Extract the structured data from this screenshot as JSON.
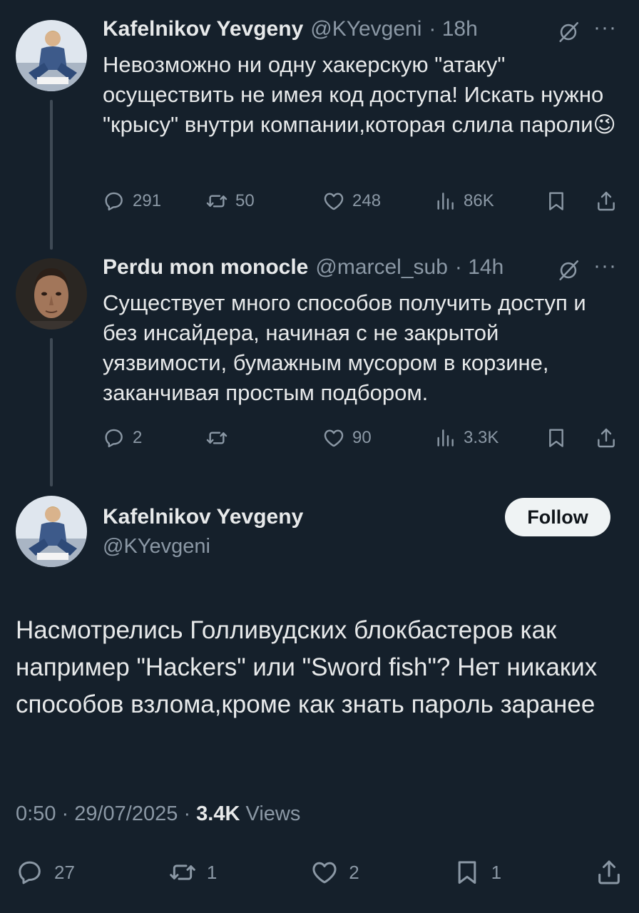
{
  "tweet1": {
    "name": "Kafelnikov Yevgeny",
    "handle": "@KYevgeni",
    "time": "· 18h",
    "text": "Невозможно ни одну хакерскую \"атаку\" осуществить не имея код доступа! Искать нужно \"крысу\" внутри компании,которая слила пароли😉",
    "replies": "291",
    "reposts": "50",
    "likes": "248",
    "views": "86K"
  },
  "tweet2": {
    "name": "Perdu mon monocle",
    "handle": "@marcel_sub",
    "time": "· 14h",
    "text": "Существует много способов получить доступ и без инсайдера, начиная с не закрытой уязвимости, бумажным мусором в корзине, заканчивая простым подбором.",
    "replies": "2",
    "reposts": "",
    "likes": "90",
    "views": "3.3K"
  },
  "main": {
    "name": "Kafelnikov Yevgeny",
    "handle": "@KYevgeni",
    "follow_label": "Follow",
    "text": "Насмотрелись Голливудских блокбастеров как например \"Hackers\" или \"Sword fish\"? Нет никаких способов взлома,кроме как знать пароль заранее",
    "time": "0:50",
    "date": "29/07/2025",
    "views_count": "3.4K",
    "views_label": "Views",
    "replies": "27",
    "reposts": "1",
    "likes": "2",
    "bookmarks": "1"
  },
  "icons": {
    "reply": "reply-icon",
    "repost": "repost-icon",
    "like": "heart-icon",
    "views": "analytics-icon",
    "bookmark": "bookmark-icon",
    "share": "share-icon",
    "more": "more-icon",
    "grok": "grok-icon"
  },
  "colors": {
    "background": "#15202b",
    "text": "#e7e9ea",
    "muted": "#8b98a5",
    "follow_bg": "#eff3f4"
  }
}
